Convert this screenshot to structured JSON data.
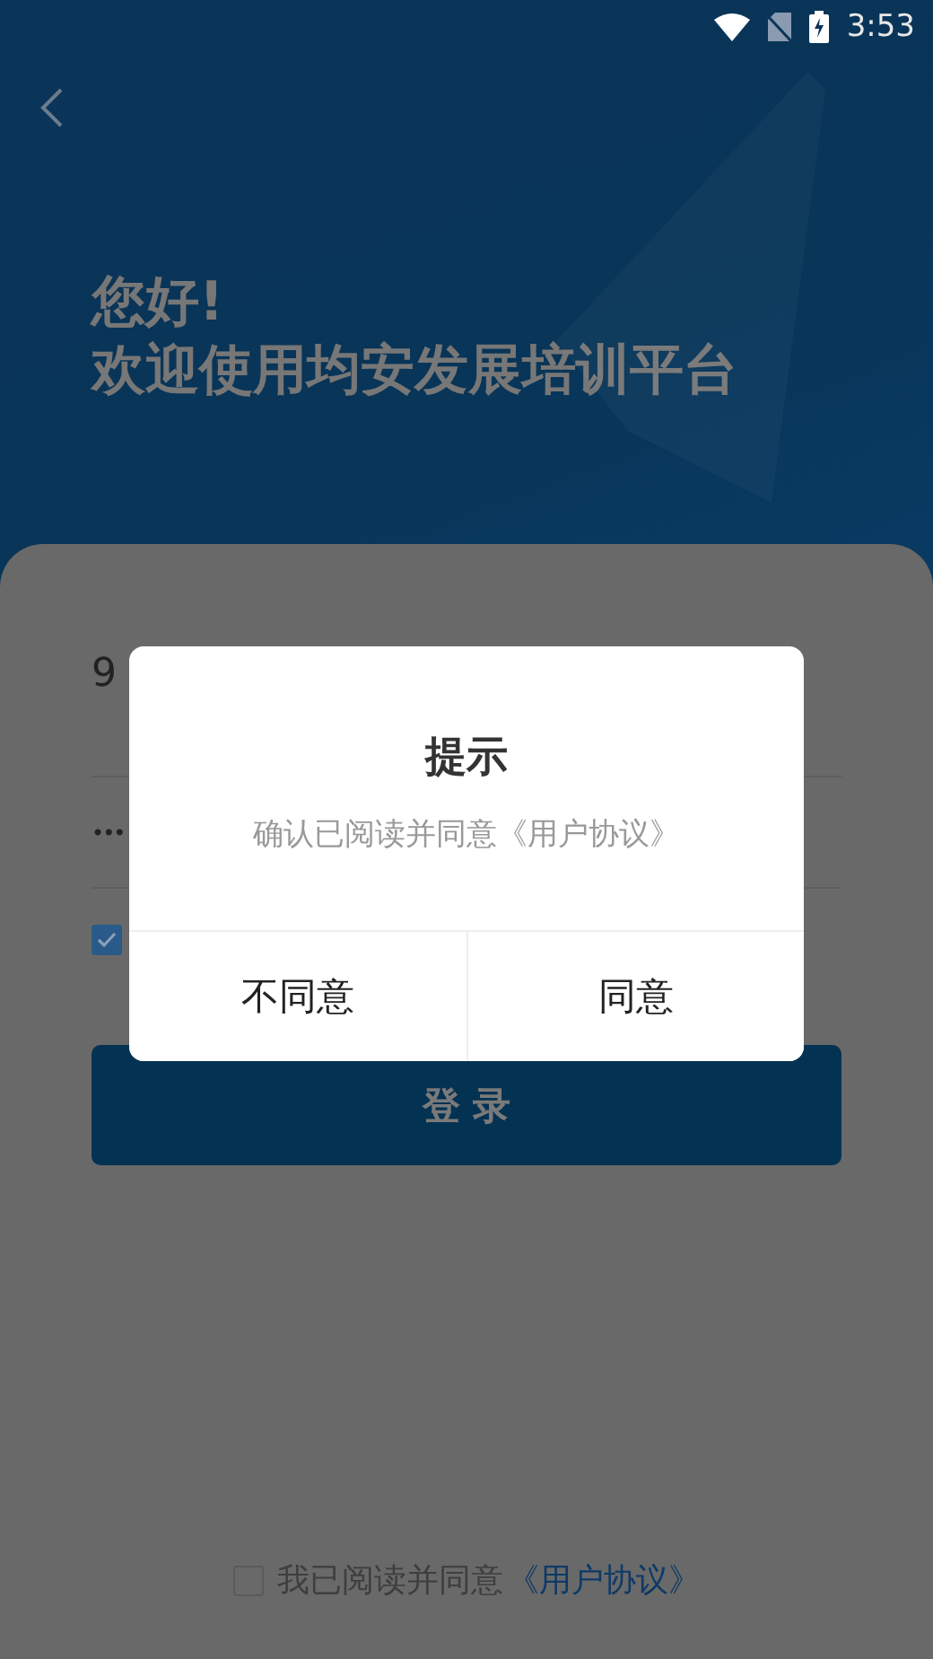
{
  "status_bar": {
    "time": "3:53"
  },
  "header": {
    "greeting": "您好!",
    "welcome": "欢迎使用均安发展培训平台"
  },
  "form": {
    "phone_value": "9",
    "password_value": "•••",
    "remember_checked": true,
    "login_button": "登 录"
  },
  "agreement": {
    "checked": false,
    "text": "我已阅读并同意",
    "link": "《用户协议》"
  },
  "dialog": {
    "title": "提示",
    "message": "确认已阅读并同意《用户协议》",
    "buttons": [
      "不同意",
      "同意"
    ]
  }
}
